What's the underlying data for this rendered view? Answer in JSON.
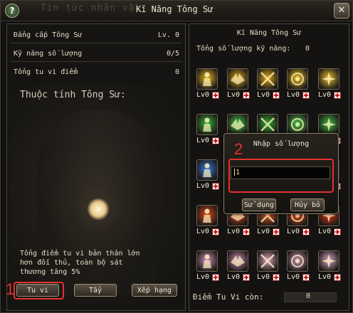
{
  "window": {
    "background_title": "Tin tức nhân vật",
    "title": "Kĩ Năng Tông Sư",
    "help_icon": "question-mark-icon",
    "close_icon": "close-x-icon"
  },
  "left": {
    "stats": [
      {
        "label": "Đẳng cấp Tông Sư",
        "value": "Lv. 0"
      },
      {
        "label": "Kỹ năng số lượng",
        "value": "0/5"
      },
      {
        "label": "Tổng tu vi điểm",
        "value": "0"
      }
    ],
    "attr_title": "Thuộc tính Tông Sư:",
    "description_lines": [
      "Tổng điểm tu vi bản thân lớn",
      "hơn đối thủ, toàn bộ sát",
      "thương tăng 5%"
    ],
    "buttons": {
      "tuvi": "Tu vi",
      "reset": "Tẩy",
      "rank": "Xếp hạng"
    }
  },
  "right": {
    "title": "Kĩ Năng Tông Sư",
    "count_label": "Tổng số lượng kỹ năng:",
    "count_value": "0",
    "level_label": "Lv0",
    "skill_rows": [
      [
        {
          "icon": "yellow-shield-icon",
          "color": "#e8b820"
        },
        {
          "icon": "wing-crest-icon",
          "color": "#d4a018"
        },
        {
          "icon": "crossed-blades-icon",
          "color": "#e0a818"
        },
        {
          "icon": "golden-spiral-icon",
          "color": "#f0c020"
        },
        {
          "icon": "golden-spark-icon",
          "color": "#e8c030"
        }
      ],
      [
        {
          "icon": "green-figure-icon",
          "color": "#38b838"
        },
        {
          "icon": "green-wing-icon",
          "color": "#40c040"
        },
        {
          "icon": "green-blades-icon",
          "color": "#30a830"
        },
        {
          "icon": "green-spiral-icon",
          "color": "#48c048"
        },
        {
          "icon": "green-spark-icon",
          "color": "#40b840"
        }
      ],
      [
        {
          "icon": "blue-figure-icon",
          "color": "#3878e0"
        },
        {
          "icon": "blue-wing-icon",
          "color": "#3a8ad8"
        },
        {
          "icon": "blue-blades-icon",
          "color": "#4070d0"
        },
        {
          "icon": "blue-spiral-icon",
          "color": "#3890e0"
        },
        {
          "icon": "blue-spark-icon",
          "color": "#4080e8"
        }
      ],
      [
        {
          "icon": "red-figure-icon",
          "color": "#e04818"
        },
        {
          "icon": "red-wing-icon",
          "color": "#d83818"
        },
        {
          "icon": "red-blades-icon",
          "color": "#e05020"
        },
        {
          "icon": "red-spiral-icon",
          "color": "#e84818"
        },
        {
          "icon": "red-ring-icon",
          "color": "#e83010"
        }
      ],
      [
        {
          "icon": "pink-figure-icon",
          "color": "#d090b8"
        },
        {
          "icon": "pink-wing-icon",
          "color": "#c888b0"
        },
        {
          "icon": "pink-blades-icon",
          "color": "#d8a0c0"
        },
        {
          "icon": "pink-spiral-icon",
          "color": "#c890b8"
        },
        {
          "icon": "pink-totem-icon",
          "color": "#d8a8c8"
        }
      ]
    ],
    "tuvi_label": "Điểm Tu Vi còn:",
    "tuvi_value": "0"
  },
  "dialog": {
    "title": "Nhập số lượng",
    "input_value": "1",
    "use_button": "Sử dụng",
    "cancel_button": "Hủy bỏ"
  },
  "annotations": {
    "step1": "1",
    "step2": "2",
    "highlight_color": "#e53030"
  }
}
